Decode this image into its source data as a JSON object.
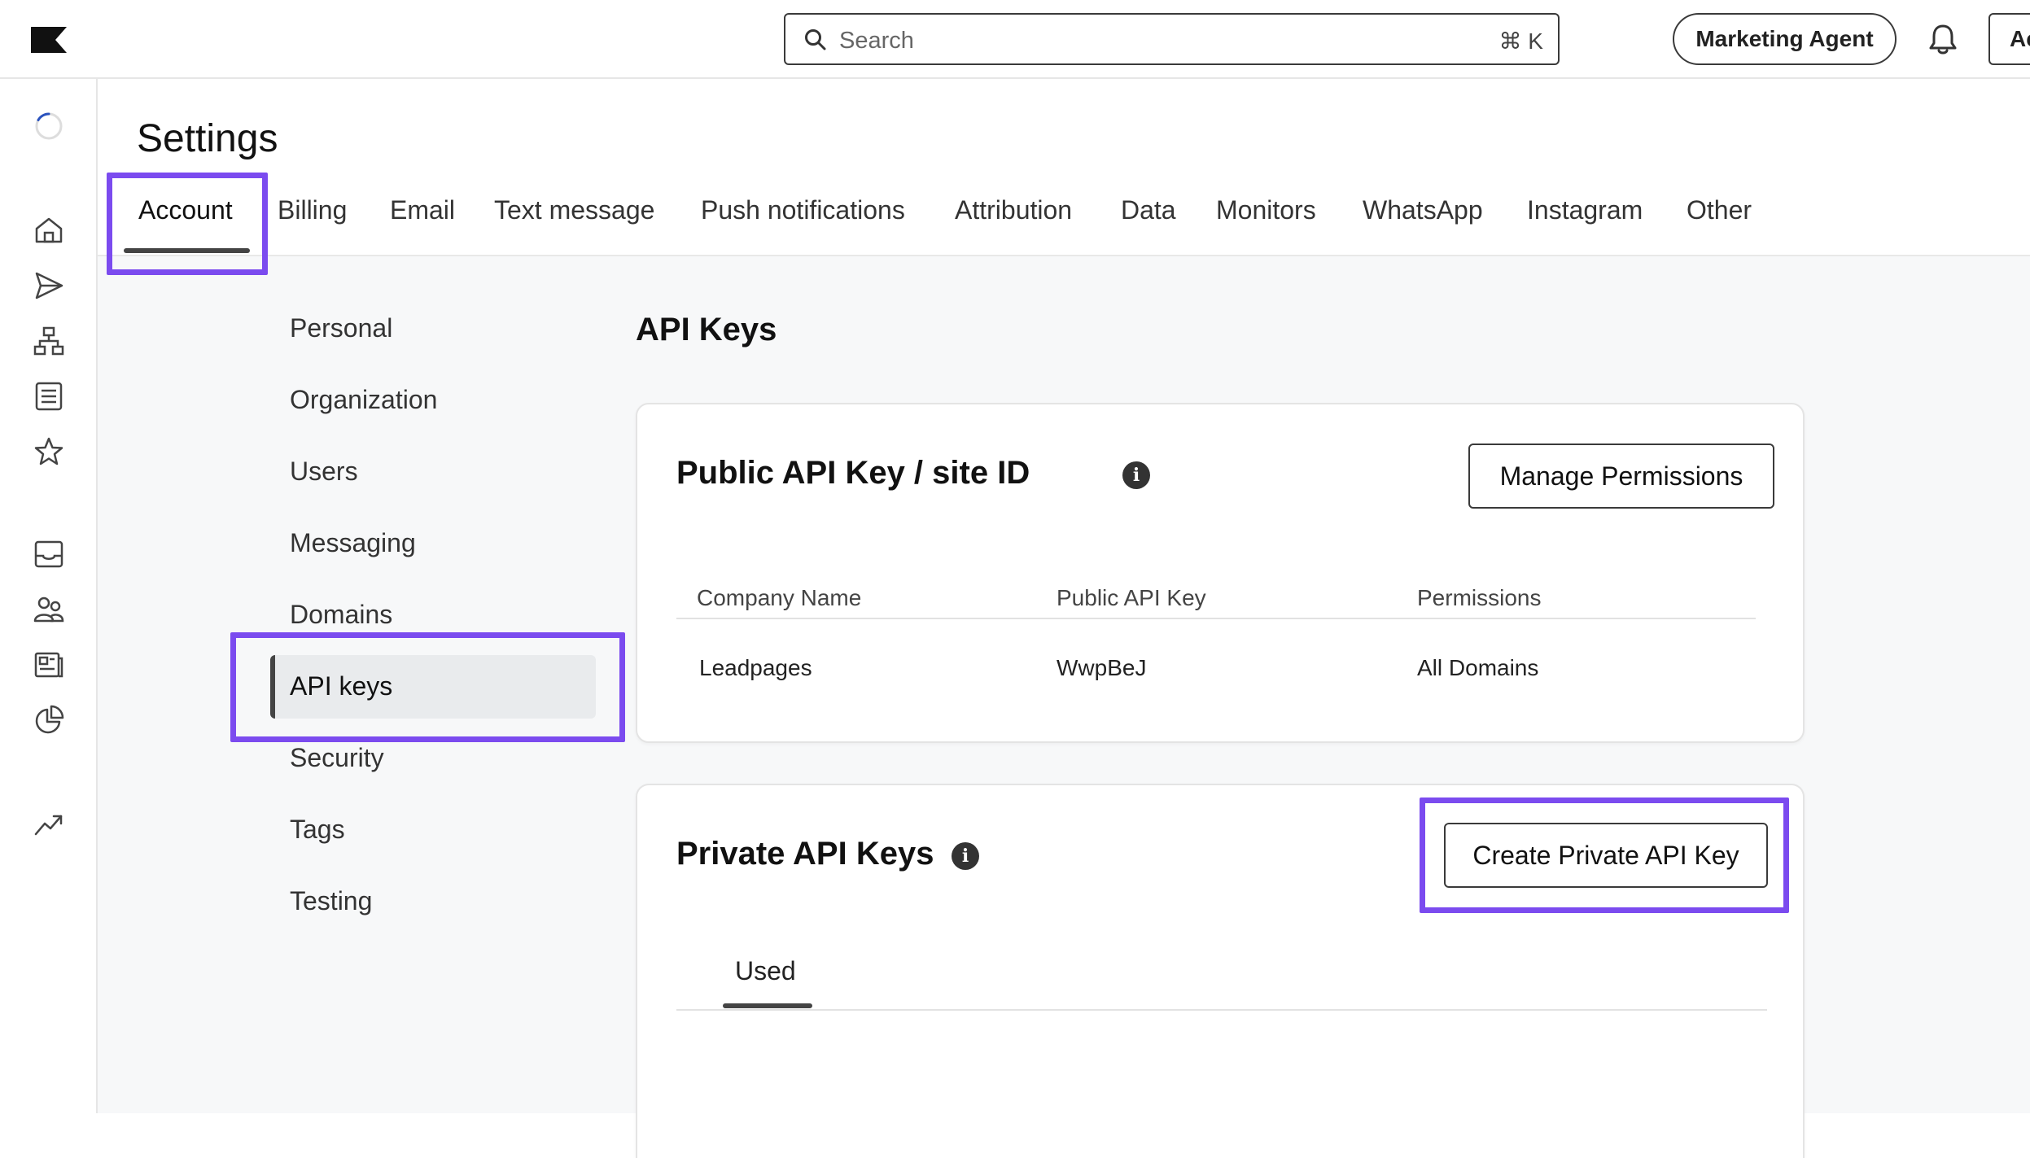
{
  "topbar": {
    "search_placeholder": "Search",
    "search_shortcut": "⌘ K",
    "agent_button": "Marketing Agent",
    "cut_button": "Ac"
  },
  "header": {
    "title": "Settings",
    "tabs": [
      "Account",
      "Billing",
      "Email",
      "Text message",
      "Push notifications",
      "Attribution",
      "Data",
      "Monitors",
      "WhatsApp",
      "Instagram",
      "Other"
    ],
    "active_tab": "Account"
  },
  "subnav": {
    "items": [
      "Personal",
      "Organization",
      "Users",
      "Messaging",
      "Domains",
      "API keys",
      "Security",
      "Tags",
      "Testing"
    ],
    "active_item": "API keys"
  },
  "main": {
    "section_title": "API Keys",
    "public_card": {
      "title": "Public API Key / site ID",
      "info": "i",
      "button": "Manage Permissions",
      "columns": [
        "Company Name",
        "Public API Key",
        "Permissions"
      ],
      "rows": [
        [
          "Leadpages",
          "WwpBeJ",
          "All Domains"
        ]
      ]
    },
    "private_card": {
      "title": "Private API Keys",
      "info": "i",
      "button": "Create Private API Key",
      "tab": "Used"
    }
  },
  "colors": {
    "highlight": "#7b4bef",
    "accent_dark": "#444444"
  }
}
